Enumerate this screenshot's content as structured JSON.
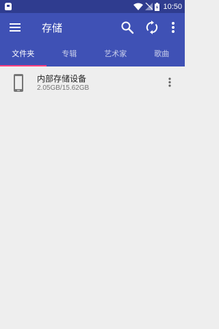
{
  "status_bar": {
    "time": "10:50",
    "icons": [
      "notification-icon",
      "wifi-icon",
      "signal-icon",
      "battery-icon"
    ]
  },
  "toolbar": {
    "title": "存储",
    "icons": [
      "menu-icon",
      "search-icon",
      "sync-icon",
      "more-vert-icon"
    ]
  },
  "tabs": [
    {
      "label": "文件夹",
      "active": true
    },
    {
      "label": "专辑",
      "active": false
    },
    {
      "label": "艺术家",
      "active": false
    },
    {
      "label": "歌曲",
      "active": false
    }
  ],
  "storage": {
    "items": [
      {
        "name": "内部存储设备",
        "size": "2.05GB/15.62GB",
        "icon": "phone-icon"
      }
    ]
  },
  "colors": {
    "primary": "#3f51b5",
    "primary_dark": "#2f3c8f",
    "accent": "#ff4081",
    "background": "#eeeeee"
  }
}
